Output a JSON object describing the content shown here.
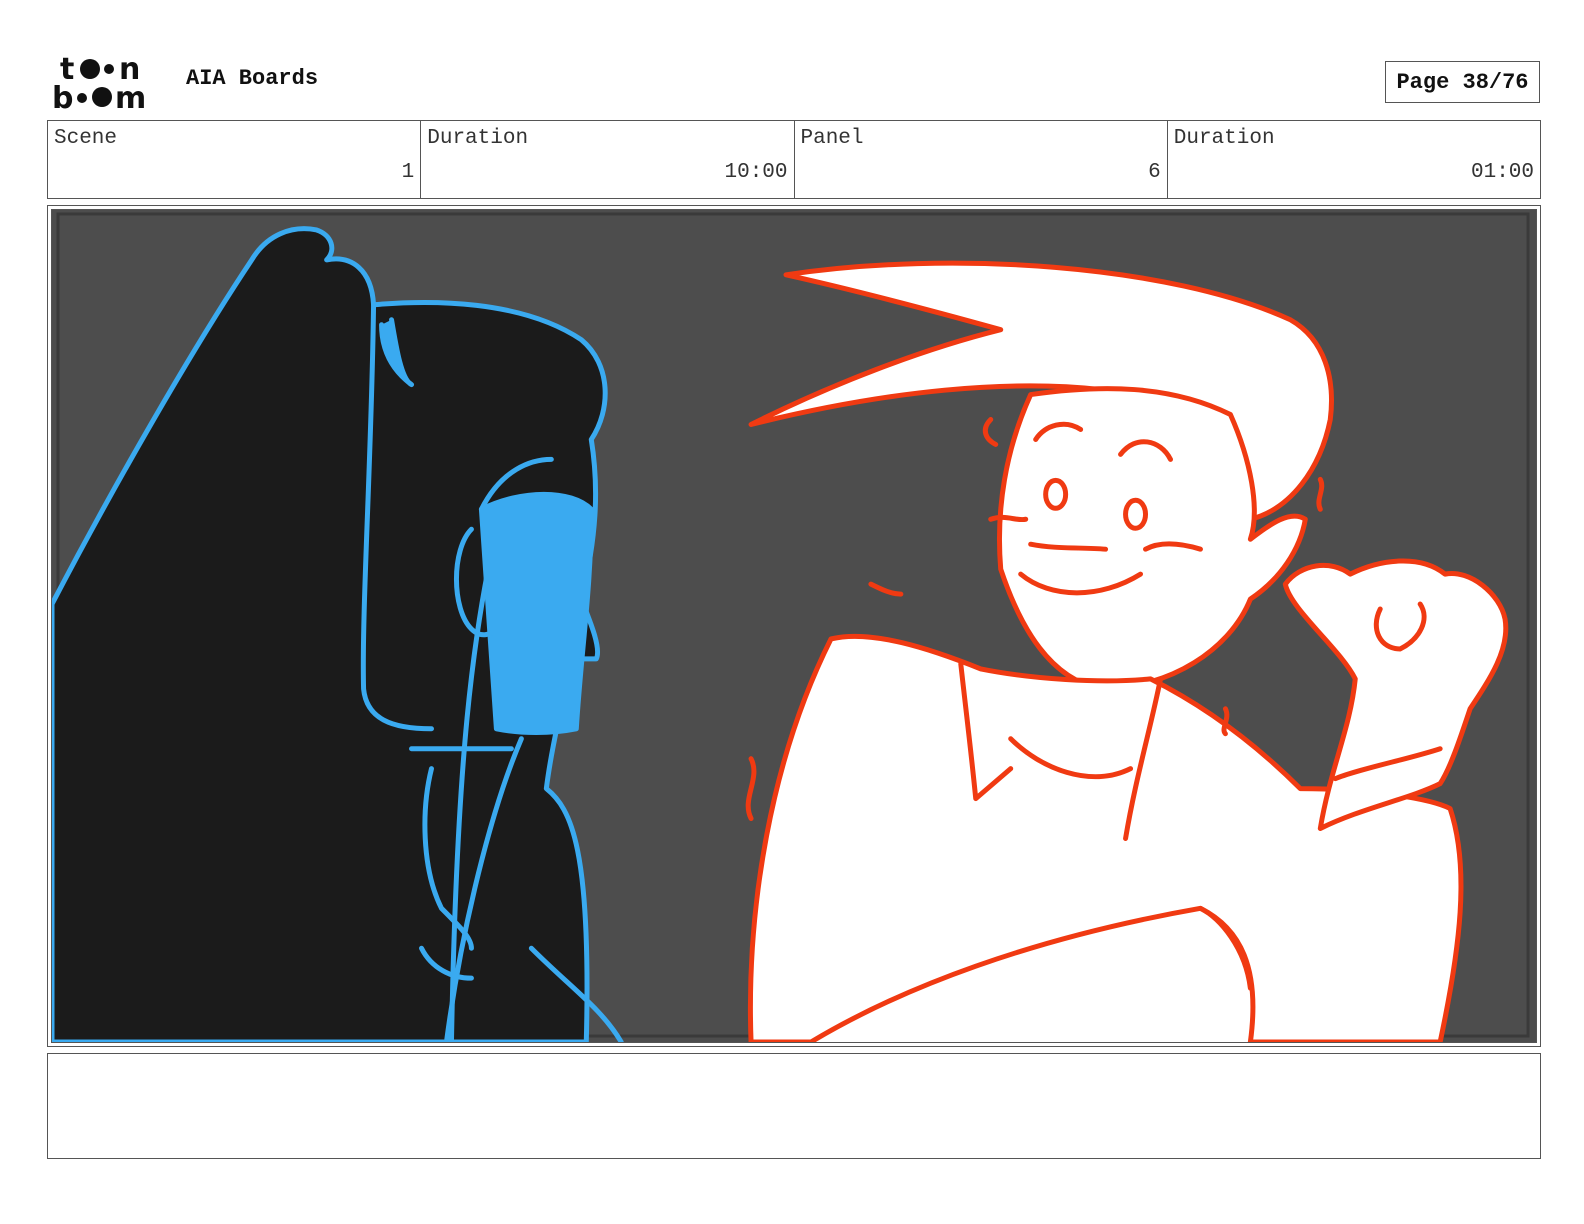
{
  "header": {
    "logo_text_top": "toon",
    "logo_text_bottom": "boom",
    "project_title": "AIA Boards",
    "page_indicator": "Page 38/76"
  },
  "info": {
    "scene_label": "Scene",
    "scene_value": "1",
    "scene_duration_label": "Duration",
    "scene_duration_value": "10:00",
    "panel_label": "Panel",
    "panel_value": "6",
    "panel_duration_label": "Duration",
    "panel_duration_value": "01:00"
  },
  "colors": {
    "panel_background": "#4d4d4d",
    "left_character_fill": "#1b1b1b",
    "left_character_line": "#3aaaf0",
    "right_character_fill": "#ffffff",
    "right_character_line": "#f03a12"
  },
  "notes": {
    "text": ""
  }
}
